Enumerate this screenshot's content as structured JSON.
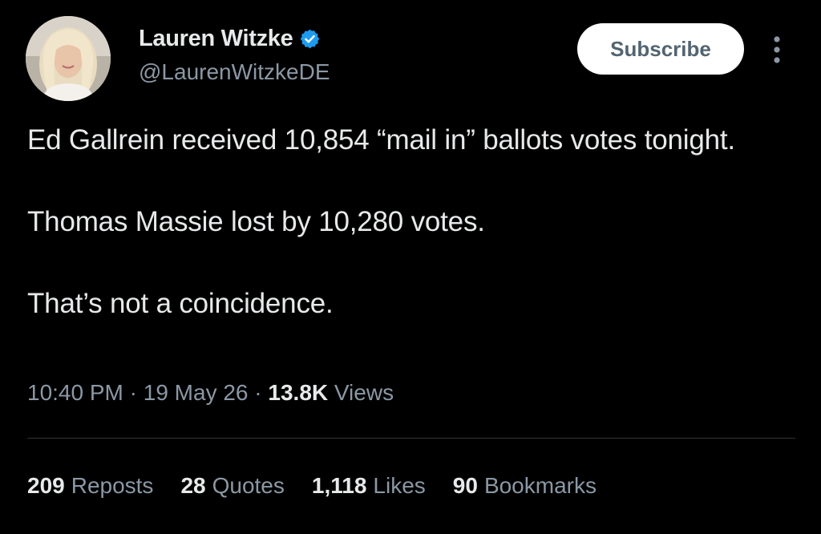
{
  "author": {
    "display_name": "Lauren Witzke",
    "handle": "@LaurenWitzkeDE",
    "verified_icon": "verified-badge-icon",
    "verified_color": "#1d9bf0"
  },
  "header": {
    "subscribe_label": "Subscribe",
    "more_icon": "more-vertical-icon"
  },
  "tweet": {
    "paragraphs": [
      "Ed Gallrein received 10,854 “mail in” ballots votes tonight.",
      "Thomas Massie lost by 10,280 votes.",
      "That’s not a coincidence."
    ],
    "time": "10:40 PM",
    "separator": " · ",
    "date": "19 May 26",
    "views_count": "13.8K",
    "views_label": "Views"
  },
  "stats": {
    "reposts": {
      "count": "209",
      "label": "Reposts"
    },
    "quotes": {
      "count": "28",
      "label": "Quotes"
    },
    "likes": {
      "count": "1,118",
      "label": "Likes"
    },
    "bookmarks": {
      "count": "90",
      "label": "Bookmarks"
    }
  },
  "colors": {
    "background": "#000000",
    "text_primary": "#e7e9ea",
    "text_secondary": "#8b98a5",
    "divider": "#2f3336"
  }
}
